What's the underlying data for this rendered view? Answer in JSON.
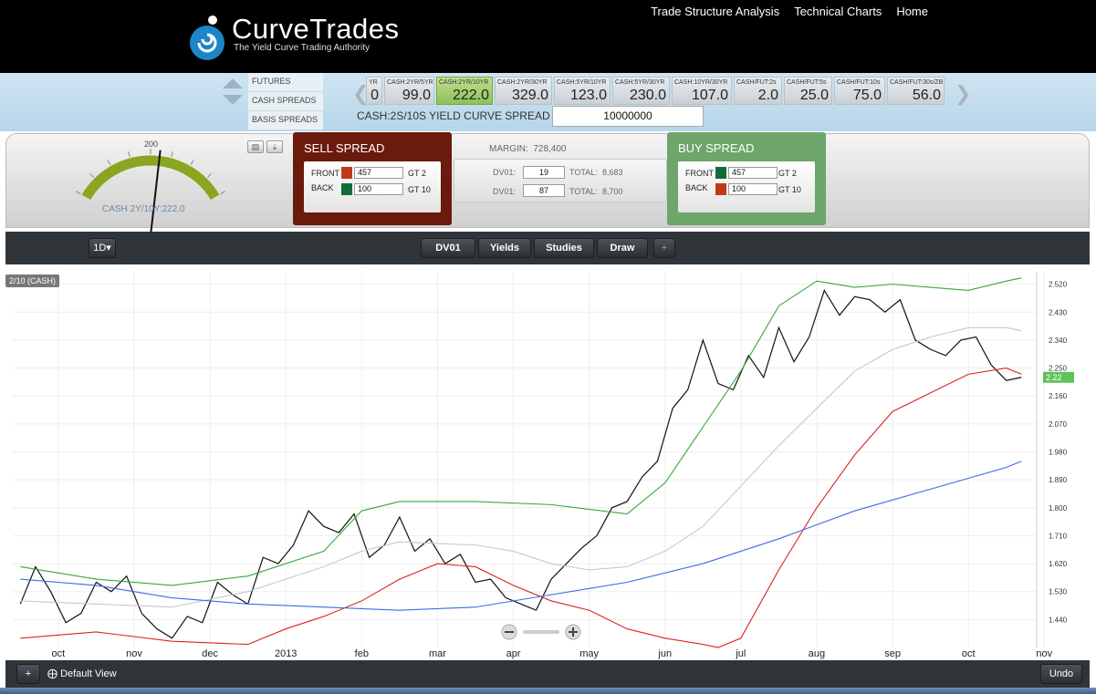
{
  "header": {
    "brand": "CurveTrades",
    "tagline": "The Yield Curve Trading Authority",
    "nav": [
      "Trade Structure Analysis",
      "Technical Charts",
      "Home"
    ]
  },
  "categories": [
    "FUTURES",
    "CASH SPREADS",
    "BASIS SPREADS"
  ],
  "tickers": [
    {
      "label": "YR",
      "value": "0"
    },
    {
      "label": "CASH:2YR/5YR",
      "value": "99.0"
    },
    {
      "label": "CASH:2YR/10YR",
      "value": "222.0",
      "selected": true
    },
    {
      "label": "CASH:2YR/30YR",
      "value": "329.0"
    },
    {
      "label": "CASH:5YR/10YR",
      "value": "123.0"
    },
    {
      "label": "CASH:5YR/30YR",
      "value": "230.0"
    },
    {
      "label": "CASH:10YR/30YR",
      "value": "107.0"
    },
    {
      "label": "CASH/FUT:2s",
      "value": "2.0"
    },
    {
      "label": "CASH/FUT:5s",
      "value": "25.0"
    },
    {
      "label": "CASH/FUT:10s",
      "value": "75.0"
    },
    {
      "label": "CASH/FUT:30s/ZB",
      "value": "56.0"
    }
  ],
  "spread": {
    "label": "CASH:2S/10S YIELD CURVE SPREAD",
    "notional": "10000000"
  },
  "gauge": {
    "top_value": "200",
    "label": "CASH 2Y/10Y:222.0",
    "reading": 222
  },
  "sell": {
    "title": "SELL SPREAD",
    "front_label": "FRONT",
    "front_value": "457",
    "front_contract": "GT 2",
    "front_color": "#c0391b",
    "back_label": "BACK",
    "back_value": "100",
    "back_contract": "GT 10",
    "back_color": "#136b3a"
  },
  "buy": {
    "title": "BUY SPREAD",
    "front_label": "FRONT",
    "front_value": "457",
    "front_contract": "GT 2",
    "front_color": "#136b3a",
    "back_label": "BACK",
    "back_value": "100",
    "back_contract": "GT 10",
    "back_color": "#c0391b"
  },
  "risk": {
    "margin_label": "MARGIN:",
    "margin_value": "728,400",
    "dv1_label": "DV01:",
    "dv1_value": "19",
    "total1_label": "TOTAL:",
    "total1_value": "8,683",
    "dv2_label": "DV01:",
    "dv2_value": "87",
    "total2_label": "TOTAL:",
    "total2_value": "8,700"
  },
  "toolbar": {
    "interval": "1D▾",
    "buttons": [
      "DV01",
      "Yields",
      "Studies",
      "Draw"
    ],
    "add": "+"
  },
  "bottom": {
    "add": "+",
    "view": "Default View",
    "undo": "Undo"
  },
  "chart_data": {
    "type": "line",
    "series_tag": "2/10 (CASH)",
    "last_value_label": "2.22",
    "x_ticks": [
      "oct",
      "nov",
      "dec",
      "2013",
      "feb",
      "mar",
      "apr",
      "may",
      "jun",
      "jul",
      "aug",
      "sep",
      "oct",
      "nov"
    ],
    "x_tick_pos": [
      0.5,
      1.5,
      2.5,
      3.5,
      4.5,
      5.5,
      6.5,
      7.5,
      8.5,
      9.5,
      10.5,
      11.5,
      12.5,
      13.5
    ],
    "xlim": [
      -0.1,
      13.4
    ],
    "y_ticks": [
      "2.520",
      "2.430",
      "2.340",
      "2.250",
      "2.160",
      "2.070",
      "1.980",
      "1.890",
      "1.800",
      "1.710",
      "1.620",
      "1.530",
      "1.440"
    ],
    "ylim": [
      1.35,
      2.56
    ],
    "grid": true,
    "series": [
      {
        "role": "price",
        "color": "#111111",
        "x": [
          0.0,
          0.2,
          0.4,
          0.6,
          0.8,
          1.0,
          1.2,
          1.4,
          1.6,
          1.8,
          2.0,
          2.2,
          2.4,
          2.6,
          2.8,
          3.0,
          3.2,
          3.4,
          3.6,
          3.8,
          4.0,
          4.2,
          4.4,
          4.6,
          4.8,
          5.0,
          5.2,
          5.4,
          5.6,
          5.8,
          6.0,
          6.2,
          6.4,
          6.6,
          6.8,
          7.0,
          7.2,
          7.4,
          7.6,
          7.8,
          8.0,
          8.2,
          8.4,
          8.6,
          8.8,
          9.0,
          9.2,
          9.4,
          9.6,
          9.8,
          10.0,
          10.2,
          10.4,
          10.6,
          10.8,
          11.0,
          11.2,
          11.4,
          11.6,
          11.8,
          12.0,
          12.2,
          12.4,
          12.6,
          12.8,
          13.0,
          13.2
        ],
        "y": [
          1.49,
          1.61,
          1.53,
          1.43,
          1.46,
          1.56,
          1.53,
          1.58,
          1.46,
          1.41,
          1.38,
          1.45,
          1.43,
          1.56,
          1.52,
          1.49,
          1.64,
          1.62,
          1.68,
          1.79,
          1.74,
          1.72,
          1.78,
          1.64,
          1.68,
          1.77,
          1.66,
          1.7,
          1.62,
          1.65,
          1.56,
          1.57,
          1.51,
          1.49,
          1.47,
          1.57,
          1.62,
          1.67,
          1.71,
          1.8,
          1.82,
          1.9,
          1.95,
          2.12,
          2.18,
          2.34,
          2.2,
          2.18,
          2.29,
          2.22,
          2.38,
          2.27,
          2.35,
          2.5,
          2.42,
          2.48,
          2.47,
          2.43,
          2.47,
          2.34,
          2.31,
          2.29,
          2.34,
          2.35,
          2.26,
          2.21,
          2.22
        ]
      },
      {
        "role": "upper-band",
        "color": "#3aa63a",
        "x": [
          0,
          1,
          2,
          3,
          4,
          4.5,
          5,
          6,
          7,
          8,
          8.5,
          9,
          9.5,
          10,
          10.5,
          11,
          11.5,
          12,
          12.5,
          13,
          13.2
        ],
        "y": [
          1.61,
          1.57,
          1.55,
          1.58,
          1.66,
          1.79,
          1.82,
          1.82,
          1.81,
          1.78,
          1.88,
          2.06,
          2.24,
          2.45,
          2.53,
          2.51,
          2.52,
          2.51,
          2.5,
          2.53,
          2.54
        ]
      },
      {
        "role": "moving-average",
        "color": "#c8c8c8",
        "x": [
          0,
          1,
          2,
          3,
          4,
          4.5,
          5,
          6,
          6.5,
          7,
          7.5,
          8,
          8.5,
          9,
          9.5,
          10,
          10.5,
          11,
          11.5,
          12,
          12.5,
          13,
          13.2
        ],
        "y": [
          1.5,
          1.49,
          1.48,
          1.53,
          1.61,
          1.66,
          1.69,
          1.68,
          1.66,
          1.62,
          1.6,
          1.61,
          1.66,
          1.74,
          1.87,
          2.0,
          2.12,
          2.24,
          2.31,
          2.35,
          2.38,
          2.38,
          2.37
        ]
      },
      {
        "role": "lower-band",
        "color": "#dd2222",
        "x": [
          0,
          1,
          2,
          3,
          3.5,
          4,
          4.5,
          5,
          5.5,
          6,
          6.5,
          7,
          7.5,
          8,
          8.5,
          9,
          9.2,
          9.5,
          10,
          10.5,
          11,
          11.5,
          12,
          12.5,
          13,
          13.2
        ],
        "y": [
          1.38,
          1.4,
          1.37,
          1.36,
          1.41,
          1.45,
          1.5,
          1.57,
          1.62,
          1.61,
          1.55,
          1.5,
          1.47,
          1.41,
          1.38,
          1.36,
          1.35,
          1.38,
          1.6,
          1.8,
          1.97,
          2.11,
          2.17,
          2.23,
          2.25,
          2.23
        ]
      },
      {
        "role": "long-average",
        "color": "#3b6de0",
        "x": [
          0,
          1,
          2,
          3,
          4,
          5,
          6,
          7,
          8,
          9,
          10,
          11,
          12,
          13,
          13.2
        ],
        "y": [
          1.57,
          1.55,
          1.51,
          1.49,
          1.48,
          1.47,
          1.48,
          1.52,
          1.56,
          1.62,
          1.7,
          1.79,
          1.86,
          1.93,
          1.95
        ]
      }
    ]
  }
}
